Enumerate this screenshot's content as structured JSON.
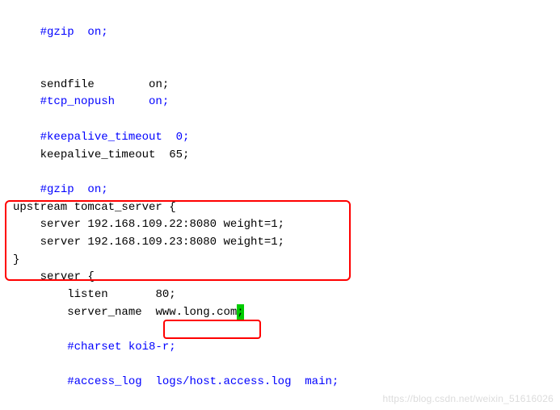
{
  "lines": {
    "l1": "#gzip  on;",
    "l2_key": "sendfile",
    "l2_val": "on;",
    "l3": "#tcp_nopush     on;",
    "l4": "#keepalive_timeout  0;",
    "l5_key": "keepalive_timeout",
    "l5_val": "65;",
    "l6": "#gzip  on;",
    "l7": "upstream tomcat_server {",
    "l8": "server 192.168.109.22:8080 weight=1;",
    "l9": "server 192.168.109.23:8080 weight=1;",
    "l10": "}",
    "l11": "server {",
    "l12_key": "listen",
    "l12_val": "80;",
    "l13_key": "server_name",
    "l13_val": "www.long.com",
    "l13_semi": ";",
    "l14": "#charset koi8-r;",
    "l15": "#access_log  logs/host.access.log  main;"
  },
  "watermark": "https://blog.csdn.net/weixin_51616026"
}
